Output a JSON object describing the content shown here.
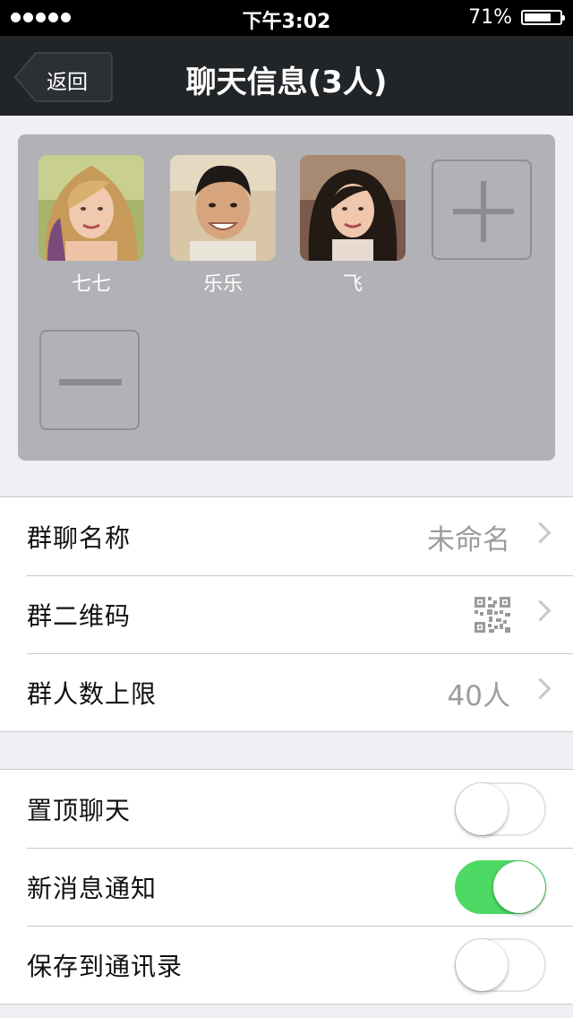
{
  "status_bar": {
    "time": "下午3:02",
    "battery_percent": "71%",
    "battery_level": 0.71,
    "signal_dots": 5
  },
  "nav": {
    "back_label": "返回",
    "title": "聊天信息(3人)"
  },
  "members": [
    {
      "name": "七七"
    },
    {
      "name": "乐乐"
    },
    {
      "name": "飞"
    }
  ],
  "member_actions": {
    "add_icon": "plus-icon",
    "remove_icon": "minus-icon"
  },
  "group_info": {
    "name_label": "群聊名称",
    "name_value": "未命名",
    "qr_label": "群二维码",
    "limit_label": "群人数上限",
    "limit_value": "40人"
  },
  "chat_settings": {
    "pin_label": "置顶聊天",
    "pin_on": false,
    "notify_label": "新消息通知",
    "notify_on": true,
    "save_label": "保存到通讯录",
    "save_on": false
  },
  "colors": {
    "toggle_on": "#4cd964",
    "nav_bg": "#222528",
    "panel_bg": "#b2b2b6"
  }
}
